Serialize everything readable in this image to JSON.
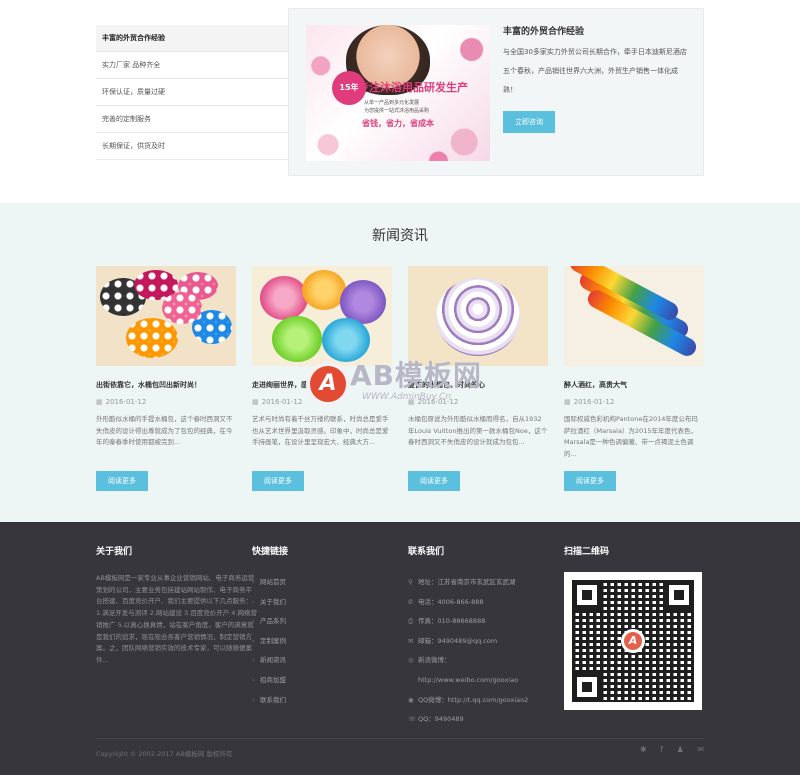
{
  "features": {
    "tabs": [
      {
        "label": "丰富的外贸合作经验"
      },
      {
        "label": "实力厂家 品种齐全"
      },
      {
        "label": "环保认证，质量过硬"
      },
      {
        "label": "完善的定制服务"
      },
      {
        "label": "长期保证，供货及时"
      }
    ],
    "active_index": 0,
    "panel": {
      "title": "丰富的外贸合作经验",
      "description": "与全国30多家实力外贸公司长期合作，牵手日本迪斯尼酒店五个春秋，产品销往世界六大洲，外贸生产销售一体化成熟！",
      "button": "立即咨询",
      "promo": {
        "badge": "15年",
        "headline": "专注沐浴用品研发生产",
        "sub1": "从单一产品到多元化发展",
        "sub2": "为您提供一站式沐浴用品采购",
        "tagline": "省钱，省力，省成本"
      }
    }
  },
  "news": {
    "heading": "新闻资讯",
    "items": [
      {
        "title": "出街依靠它，水桶包凹出新时尚！",
        "date": "2016-01-12",
        "excerpt": "外形酷似水桶的手提水桶包，这个春时西洞又不失俏皮的设计得出尊就成为了包包的经典，在今年的秦春季时使用都被完到...",
        "button": "阅读更多"
      },
      {
        "title": "走进绚丽世界，感受艺术魅力",
        "date": "2016-01-12",
        "excerpt": "艺术与时尚有着千丝万缕的联系，时尚总是爱手也从艺术世界里汲取灵感。印象中，时尚总是爱手持画笔，在设计里呈现宏大、经典大方...",
        "button": "阅读更多"
      },
      {
        "title": "复古的水桶包，时尚的心",
        "date": "2016-01-12",
        "excerpt": "水桶包原说为外形酷似水桶而得名，自从1932年Louis Vuitton推出的第一款水桶包Noe，这个春时西洞又不失俏皮的设计就成为包包...",
        "button": "阅读更多"
      },
      {
        "title": "醉人酒红，高贵大气",
        "date": "2016-01-12",
        "excerpt": "国际权威色彩机构Pantone在2014年度公布玛萨拉酒红（Marsala）为2015年年度代表色，Marsala是一种色调偏暖、带一点褐泥土色调的...",
        "button": "阅读更多"
      }
    ]
  },
  "watermark": {
    "brand": "AB模板网",
    "url": "WWW.AdminBuy.Cn",
    "logo_letter": "A"
  },
  "footer": {
    "about": {
      "title": "关于我们",
      "text": "AB模板网是一家专业从事企业营销网站、电子商务运营策划的公司，主要业务包括建站网站制作、电子商务平台搭建、百度竞价开户、我们主要提供以下几点服务：1.满足开发与测评 2.网站建设 3.百度竞价开户 4.网络营销推广 5.以真心换真情，站在客户角度，客户的满意就是我们的追求，现在现合各客户营销情况，制定营销方案。之，团队网络营销实效的技术专家，可以随随便案件..."
    },
    "links": {
      "title": "快捷链接",
      "items": [
        "网站首页",
        "关于我们",
        "产品系列",
        "定制案例",
        "新闻资讯",
        "招商加盟",
        "联系我们"
      ]
    },
    "contact": {
      "title": "联系我们",
      "items": [
        {
          "icon": "location-icon",
          "glyph": "⚲",
          "text": "地址：江苏省南京市玄武区玄武湖"
        },
        {
          "icon": "phone-icon",
          "glyph": "✆",
          "text": "电话：4006-866-888"
        },
        {
          "icon": "fax-icon",
          "glyph": "⎙",
          "text": "传真：010-88668888"
        },
        {
          "icon": "mail-icon",
          "glyph": "✉",
          "text": "邮箱：9490489@qq.com"
        },
        {
          "icon": "weibo-icon",
          "glyph": "◎",
          "text": "新浪微博："
        },
        {
          "icon": "none",
          "glyph": "",
          "text": "http://www.weibo.com/gooxiao"
        },
        {
          "icon": "qq-icon",
          "glyph": "◉",
          "text": "QQ微博：http://t.qq.com/gooxiao2"
        },
        {
          "icon": "chat-icon",
          "glyph": "☏",
          "text": "QQ：9490489"
        }
      ]
    },
    "qr": {
      "title": "扫描二维码",
      "center_letter": "A"
    },
    "copyright": "Copyright © 2002-2017 AB模板网 版权所有",
    "social": [
      "✱",
      "f",
      "♟",
      "✉"
    ]
  },
  "colors": {
    "accent": "#5bc0de",
    "footer_bg": "#37363c",
    "news_bg": "#eef5f5",
    "promo_pink": "#e03c7d"
  }
}
